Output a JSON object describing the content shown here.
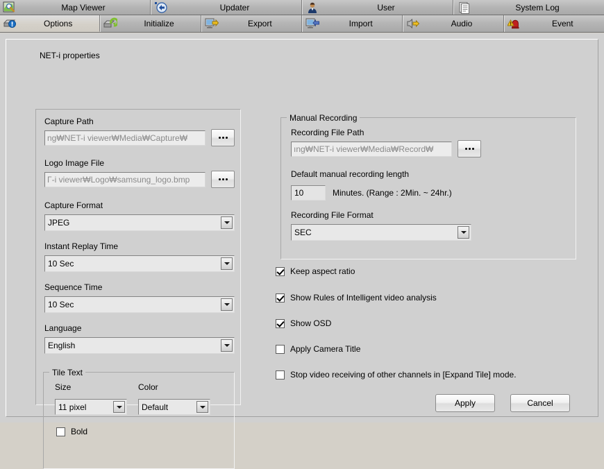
{
  "top_tabs": [
    {
      "label": "Map Viewer",
      "icon": "map-viewer-icon"
    },
    {
      "label": "Updater",
      "icon": "updater-icon"
    },
    {
      "label": "User",
      "icon": "user-icon"
    },
    {
      "label": "System Log",
      "icon": "system-log-icon"
    }
  ],
  "sub_tabs": [
    {
      "label": "Options",
      "icon": "options-drive-icon",
      "active": true
    },
    {
      "label": "Initialize",
      "icon": "initialize-drive-icon",
      "active": false
    },
    {
      "label": "Export",
      "icon": "export-monitor-icon",
      "active": false
    },
    {
      "label": "Import",
      "icon": "import-monitor-icon",
      "active": false
    },
    {
      "label": "Audio",
      "icon": "audio-speaker-icon",
      "active": false
    },
    {
      "label": "Event",
      "icon": "event-siren-icon",
      "active": false
    }
  ],
  "page": {
    "title": "NET-i properties"
  },
  "left": {
    "capture_path": {
      "label": "Capture Path",
      "value": "ng₩NET-i viewer₩Media₩Capture₩",
      "browse_label": "..."
    },
    "logo_image_file": {
      "label": "Logo Image File",
      "value": "Γ-i viewer₩Logo₩samsung_logo.bmp",
      "browse_label": "..."
    },
    "capture_format": {
      "label": "Capture Format",
      "value": "JPEG"
    },
    "instant_replay_time": {
      "label": "Instant Replay Time",
      "value": "10 Sec"
    },
    "sequence_time": {
      "label": "Sequence Time",
      "value": "10 Sec"
    },
    "language": {
      "label": "Language",
      "value": "English"
    },
    "tile_text": {
      "title": "Tile Text",
      "size_label": "Size",
      "size_value": "11 pixel",
      "color_label": "Color",
      "color_value": "Default",
      "bold_label": "Bold",
      "bold_checked": false
    }
  },
  "right": {
    "manual_recording": {
      "title": "Manual Recording",
      "file_path_label": "Recording File Path",
      "file_path_value": "ıng₩NET-i viewer₩Media₩Record₩",
      "browse_label": "...",
      "length_label": "Default manual recording length",
      "length_value": "10",
      "length_units": "Minutes.   (Range : 2Min. ~ 24hr.)",
      "file_format_label": "Recording File Format",
      "file_format_value": "SEC"
    },
    "checkboxes": [
      {
        "label": "Keep aspect ratio",
        "checked": true
      },
      {
        "label": "Show Rules of Intelligent video analysis",
        "checked": true
      },
      {
        "label": "Show OSD",
        "checked": true
      },
      {
        "label": "Apply Camera Title",
        "checked": false
      },
      {
        "label": "Stop video receiving of other channels in [Expand Tile] mode.",
        "checked": false
      }
    ]
  },
  "footer": {
    "apply_label": "Apply",
    "cancel_label": "Cancel"
  },
  "colors": {
    "window_bg": "#d0d0d0",
    "tabbar_bg": "#b4b4b4",
    "field_bg": "#ececec",
    "disabled_text": "#8a8a8a"
  }
}
